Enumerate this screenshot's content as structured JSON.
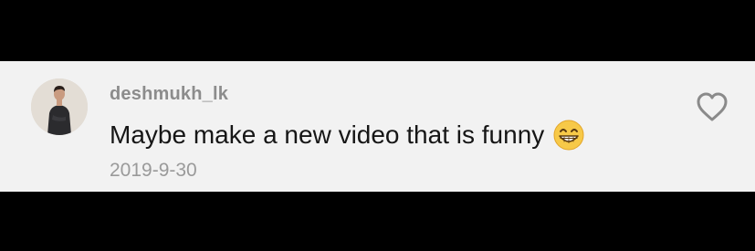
{
  "comment": {
    "username": "deshmukh_lk",
    "text": "Maybe make a new video that is funny",
    "emoji": "grinning-face-with-smiling-eyes-emoji",
    "date": "2019-9-30"
  },
  "icons": {
    "like": "heart-outline-icon"
  },
  "colors": {
    "background": "#000000",
    "card": "#f2f2f2",
    "username": "#8c8c8c",
    "text": "#161616",
    "date": "#9a9a9a",
    "heart": "#8a8a8a",
    "emoji": "#f7c948"
  }
}
